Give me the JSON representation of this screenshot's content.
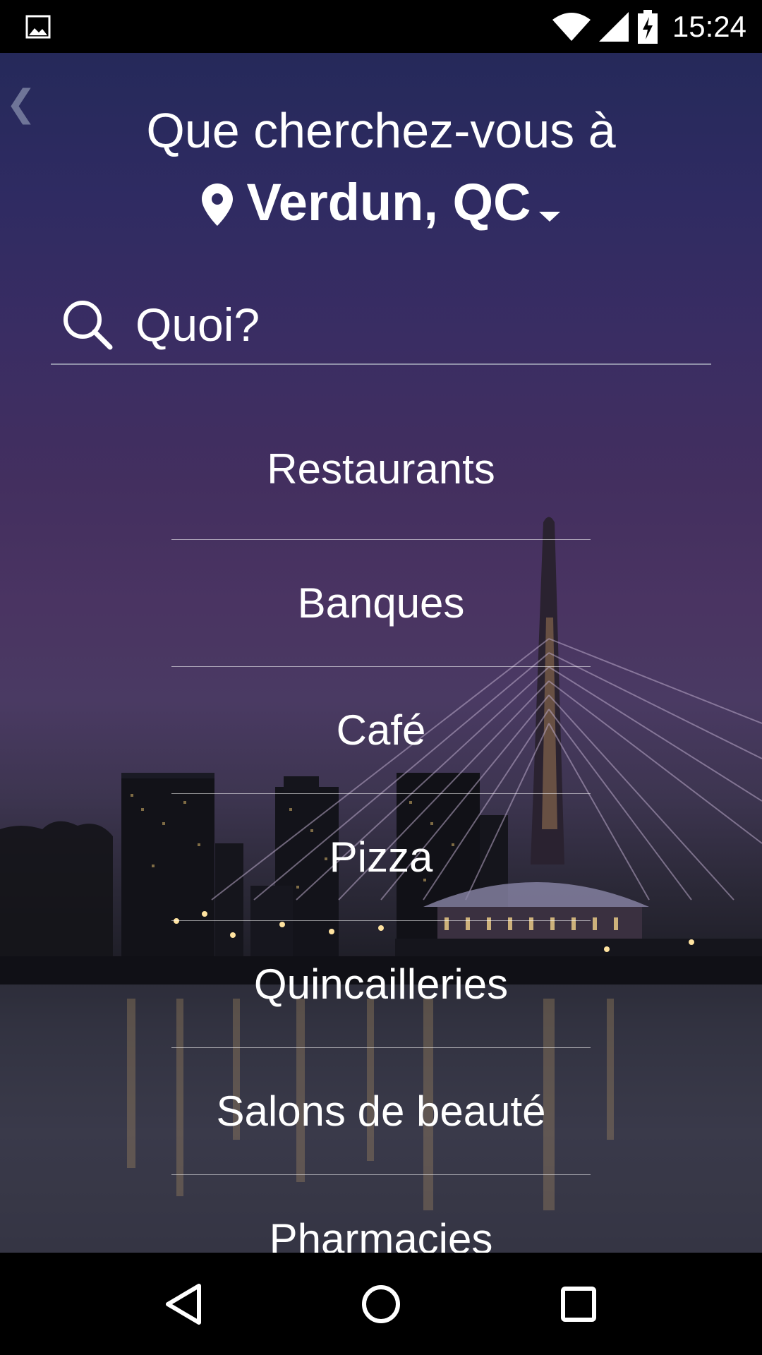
{
  "status_bar": {
    "time": "15:24",
    "icons": [
      "image-notification-icon",
      "wifi-icon",
      "signal-icon",
      "battery-charging-icon"
    ]
  },
  "header": {
    "back_icon": "chevron-left-icon",
    "prompt": "Que cherchez-vous à",
    "location": "Verdun, QC",
    "location_icon": "map-pin-icon",
    "dropdown_icon": "caret-down-icon"
  },
  "search": {
    "icon": "search-icon",
    "placeholder": "Quoi?",
    "value": ""
  },
  "categories": [
    {
      "label": "Restaurants"
    },
    {
      "label": "Banques"
    },
    {
      "label": "Café"
    },
    {
      "label": "Pizza"
    },
    {
      "label": "Quincailleries"
    },
    {
      "label": "Salons de beauté"
    },
    {
      "label": "Pharmacies"
    }
  ],
  "nav_bar": {
    "icons": [
      "back-triangle-icon",
      "home-circle-icon",
      "recents-square-icon"
    ]
  },
  "colors": {
    "text": "#ffffff",
    "status_bar_bg": "#000000",
    "nav_bar_bg": "#000000",
    "sky_top": "#25295a",
    "sky_mid": "#4a3462",
    "divider": "#8f8fa8"
  }
}
